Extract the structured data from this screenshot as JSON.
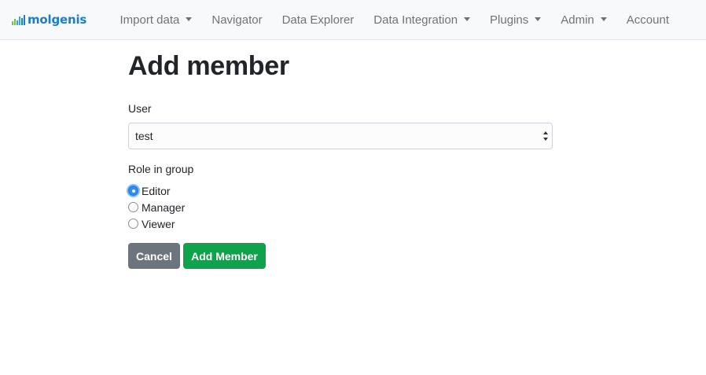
{
  "brand": {
    "name": "molgenis",
    "color": "#1a7fc4",
    "bar_colors": [
      "#7ac143",
      "#7ac143",
      "#2fa7d8",
      "#2fa7d8",
      "#1a7fc4",
      "#1a7fc4"
    ]
  },
  "nav": {
    "items": [
      {
        "label": "Import data",
        "dropdown": true
      },
      {
        "label": "Navigator",
        "dropdown": false
      },
      {
        "label": "Data Explorer",
        "dropdown": false
      },
      {
        "label": "Data Integration",
        "dropdown": true
      },
      {
        "label": "Plugins",
        "dropdown": true
      },
      {
        "label": "Admin",
        "dropdown": true
      },
      {
        "label": "Account",
        "dropdown": false
      }
    ]
  },
  "page": {
    "title": "Add member"
  },
  "form": {
    "user_label": "User",
    "user_value": "test",
    "role_label": "Role in group",
    "roles": [
      {
        "label": "Editor",
        "checked": true
      },
      {
        "label": "Manager",
        "checked": false
      },
      {
        "label": "Viewer",
        "checked": false
      }
    ],
    "cancel_label": "Cancel",
    "submit_label": "Add Member"
  },
  "colors": {
    "cancel_button": "#6c757d",
    "submit_button": "#0ea24d",
    "radio_checked": "#2f8cf0"
  }
}
